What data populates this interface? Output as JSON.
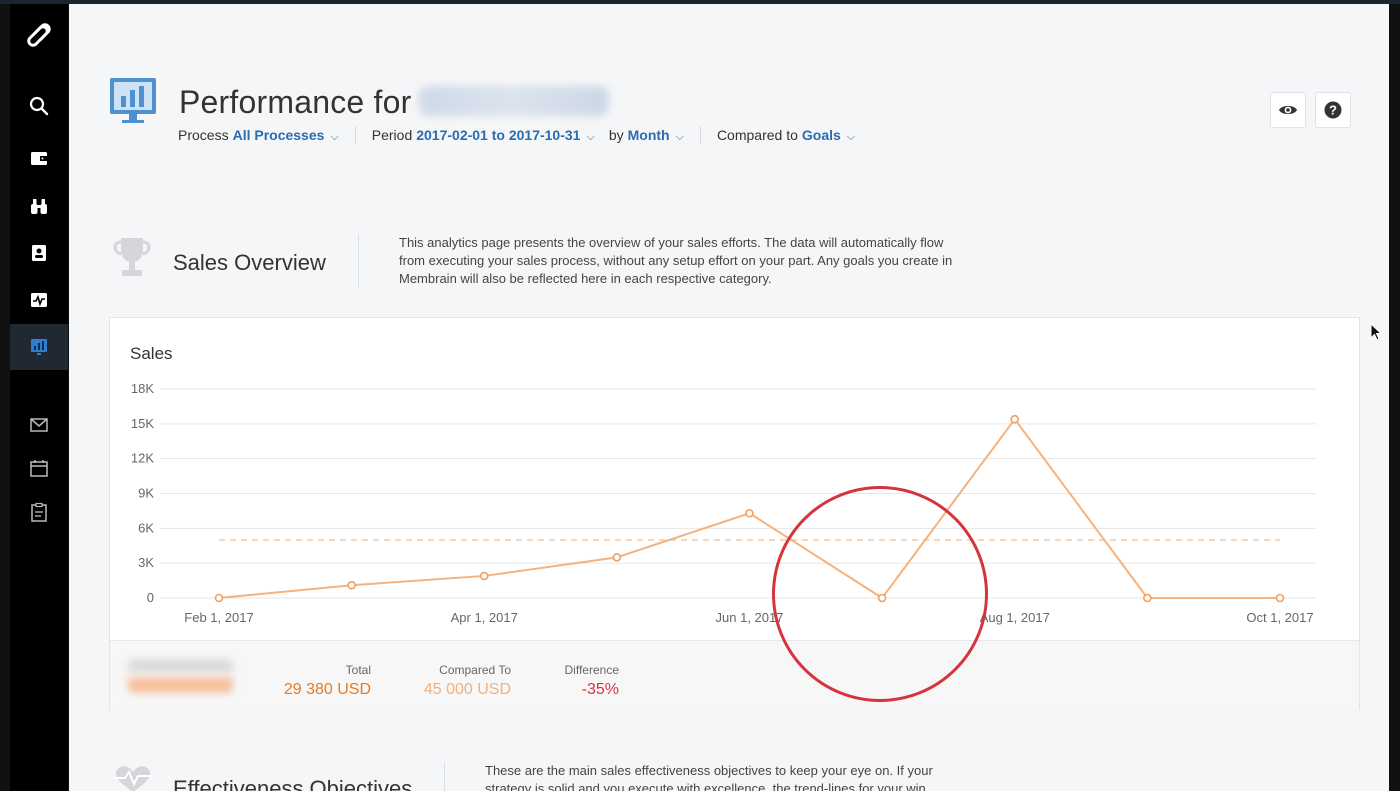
{
  "header": {
    "title": "Performance for",
    "filters": {
      "process_label": "Process",
      "process_value": "All Processes",
      "period_label": "Period",
      "period_value": "2017-02-01 to 2017-10-31",
      "by_label": "by",
      "by_value": "Month",
      "compared_label": "Compared to",
      "compared_value": "Goals"
    },
    "buttons": [
      {
        "icon": "eye-icon"
      },
      {
        "icon": "help-icon"
      }
    ]
  },
  "sidebar": {
    "items": [
      {
        "icon": "search-icon"
      },
      {
        "icon": "wallet-icon"
      },
      {
        "icon": "binoculars-icon"
      },
      {
        "icon": "contacts-icon"
      },
      {
        "icon": "activity-icon"
      },
      {
        "icon": "analytics-icon",
        "active": true
      },
      {
        "icon": "mail-icon"
      },
      {
        "icon": "calendar-icon"
      },
      {
        "icon": "clipboard-icon"
      }
    ]
  },
  "sales_overview": {
    "title": "Sales Overview",
    "description": "This analytics page presents the overview of your sales efforts. The data will automatically flow from executing your sales process, without any setup effort on your part. Any goals you create in Membrain will also be reflected here in each respective category."
  },
  "sales_card": {
    "title": "Sales",
    "stats": [
      {
        "label": "Total",
        "value": "29 380 USD",
        "color": "#ea7a1f"
      },
      {
        "label": "Compared To",
        "value": "45 000 USD",
        "color": "#f3b07a"
      },
      {
        "label": "Difference",
        "value": "-35%",
        "color": "#d6343b"
      }
    ]
  },
  "chart_data": {
    "type": "line",
    "x_tick_labels": [
      "Feb 1, 2017",
      "Apr 1, 2017",
      "Jun 1, 2017",
      "Aug 1, 2017",
      "Oct 1, 2017"
    ],
    "y_tick_labels": [
      "0",
      "3K",
      "6K",
      "9K",
      "12K",
      "15K",
      "18K"
    ],
    "ylim": [
      0,
      18000
    ],
    "points": [
      {
        "month": "2017-02",
        "value": 0
      },
      {
        "month": "2017-03",
        "value": 1100
      },
      {
        "month": "2017-04",
        "value": 1900
      },
      {
        "month": "2017-05",
        "value": 3500
      },
      {
        "month": "2017-06",
        "value": 7300
      },
      {
        "month": "2017-07",
        "value": 0
      },
      {
        "month": "2017-08",
        "value": 15400
      },
      {
        "month": "2017-09",
        "value": 0
      },
      {
        "month": "2017-10",
        "value": 0
      }
    ],
    "goal_value": 5000,
    "line_color": "#f5b27d",
    "goal_color": "#f7c7a4",
    "grid": true
  },
  "effectiveness": {
    "title": "Effectiveness Objectives",
    "description": "These are the main sales effectiveness objectives to keep your eye on. If your strategy is solid and you execute with excellence, the trend-lines for your win"
  }
}
